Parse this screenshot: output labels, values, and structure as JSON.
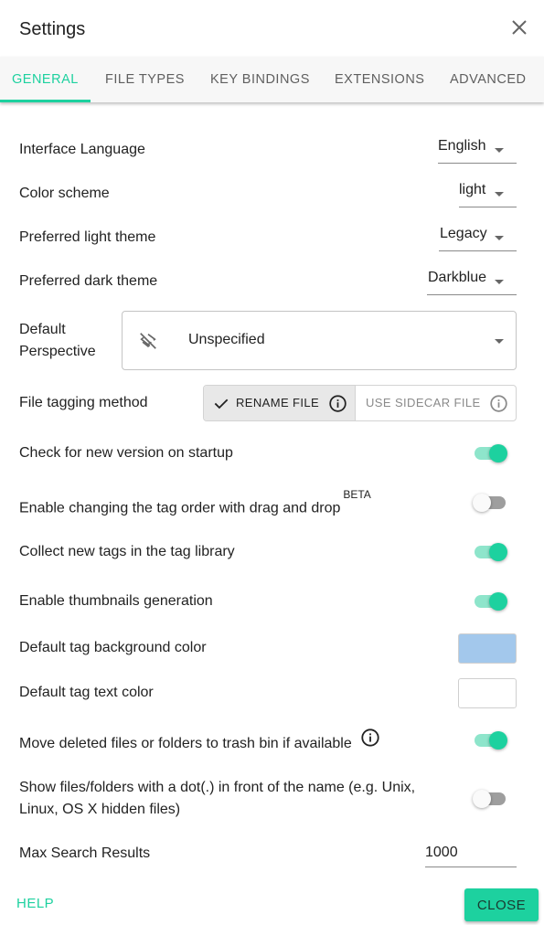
{
  "dialog": {
    "title": "Settings"
  },
  "tabs": [
    {
      "label": "GENERAL",
      "active": true
    },
    {
      "label": "FILE TYPES"
    },
    {
      "label": "KEY BINDINGS"
    },
    {
      "label": "EXTENSIONS"
    },
    {
      "label": "ADVANCED"
    }
  ],
  "settings": {
    "interface_language": {
      "label": "Interface Language",
      "value": "English"
    },
    "color_scheme": {
      "label": "Color scheme",
      "value": "light"
    },
    "light_theme": {
      "label": "Preferred light theme",
      "value": "Legacy"
    },
    "dark_theme": {
      "label": "Preferred dark theme",
      "value": "Darkblue"
    },
    "default_perspective": {
      "label_line1": "Default",
      "label_line2": "Perspective",
      "value": "Unspecified"
    },
    "tagging_method": {
      "label": "File tagging method",
      "options": [
        "RENAME FILE",
        "USE SIDECAR FILE"
      ],
      "selected": "RENAME FILE"
    },
    "check_version": {
      "label": "Check for new version on startup",
      "enabled": true
    },
    "drag_drop_tags": {
      "label": "Enable changing the tag order with drag and drop",
      "badge": "BETA",
      "enabled": false
    },
    "collect_tags": {
      "label": "Collect new tags in the tag library",
      "enabled": true
    },
    "thumbnails": {
      "label": "Enable thumbnails generation",
      "enabled": true
    },
    "tag_bg_color": {
      "label": "Default tag background color",
      "color": "#a3c8ec"
    },
    "tag_text_color": {
      "label": "Default tag text color",
      "color": "#ffffff"
    },
    "trash_bin": {
      "label": "Move deleted files or folders to trash bin if available",
      "enabled": true
    },
    "hidden_files": {
      "label_line1": "Show files/folders with a dot(.) in front of the name (e.g. Unix,",
      "label_line2": "Linux, OS X hidden files)",
      "enabled": false
    },
    "max_search": {
      "label": "Max Search Results",
      "value": "1000"
    }
  },
  "footer": {
    "help_label": "HELP",
    "close_label": "CLOSE"
  },
  "colors": {
    "accent": "#1dd19f"
  }
}
